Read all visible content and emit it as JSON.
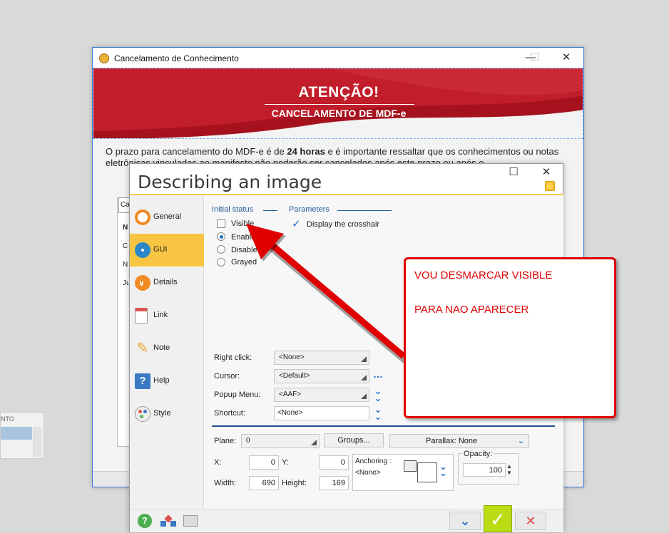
{
  "bg_window": {
    "title": "Cancelamento de Conhecimento",
    "banner_title": "ATENÇÃO!",
    "banner_subtitle": "CANCELAMENTO DE MDF-e",
    "notice_prefix": "O prazo para cancelamento do MDF-e é de ",
    "notice_bold": "24 horas",
    "notice_suffix": " e é importante ressaltar que os conhecimentos ou notas eletrônicas vinculadas ao manifesto não poderão ser cancelados após este prazo ou após o",
    "tab_label": "Ca",
    "side_labels": [
      "N",
      "C",
      "N",
      "Ju"
    ]
  },
  "left_widget": {
    "label": "NTO"
  },
  "dialog": {
    "title": "Describing an image",
    "sidebar": [
      {
        "label": "General",
        "icon": "general-icon",
        "color": "#f08a24"
      },
      {
        "label": "GUI",
        "icon": "eye-icon",
        "color": "#2a87c8",
        "active": true
      },
      {
        "label": "Details",
        "icon": "details-icon",
        "color": "#f08a24"
      },
      {
        "label": "Link",
        "icon": "link-icon",
        "color": "#d9534f"
      },
      {
        "label": "Note",
        "icon": "pencil-icon",
        "color": "#e8a62b"
      },
      {
        "label": "Help",
        "icon": "help-icon",
        "color": "#3b79c4"
      },
      {
        "label": "Style",
        "icon": "palette-icon",
        "color": "#c0b030"
      }
    ],
    "initial_status": {
      "group_label": "Initial status",
      "visible_label": "Visible",
      "visible_checked": false,
      "enabled_label": "Enabled",
      "disabled_label": "Disabled",
      "grayed_label": "Grayed",
      "selected": "Enabled"
    },
    "parameters": {
      "group_label": "Parameters",
      "crosshair_label": "Display the crosshair",
      "crosshair_checked": true
    },
    "fields": {
      "right_click_label": "Right click:",
      "right_click_value": "<None>",
      "cursor_label": "Cursor:",
      "cursor_value": "<Default>",
      "popup_label": "Popup Menu:",
      "popup_value": "<AAF>",
      "shortcut_label": "Shortcut:",
      "shortcut_value": "<None>"
    },
    "plane": {
      "plane_label": "Plane:",
      "plane_value": "0",
      "groups_label": "Groups...",
      "parallax_label": "Parallax: None"
    },
    "geometry": {
      "x_label": "X:",
      "x_value": "0",
      "y_label": "Y:",
      "y_value": "0",
      "width_label": "Width:",
      "width_value": "690",
      "height_label": "Height:",
      "height_value": "169",
      "anchoring_label": "Anchoring :",
      "anchoring_value": "<None>",
      "opacity_label": "Opacity:",
      "opacity_value": "100"
    }
  },
  "annotation": {
    "line1": "VOU DESMARCAR VISIBLE",
    "line2": "PARA NAO APARECER",
    "color": "#e00000"
  }
}
